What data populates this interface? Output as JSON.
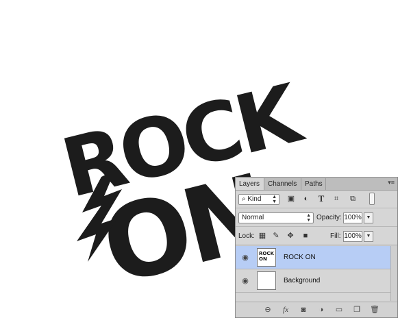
{
  "artwork": {
    "line1": "ROCK",
    "line2": "ON"
  },
  "colors": {
    "artwork": "#1c1c1c",
    "selected_layer": "#b7cdf5",
    "panel": "#d6d6d6"
  },
  "panel": {
    "tabs": [
      {
        "label": "Layers",
        "active": true
      },
      {
        "label": "Channels",
        "active": false
      },
      {
        "label": "Paths",
        "active": false
      }
    ],
    "menu_icon": "panel-menu-icon",
    "filter": {
      "kind_label": "Kind",
      "icons": [
        "image-filter-icon",
        "adjustment-filter-icon",
        "type-filter-icon",
        "shape-filter-icon",
        "smart-object-filter-icon"
      ]
    },
    "blend": {
      "mode": "Normal",
      "opacity_label": "Opacity:",
      "opacity_value": "100%"
    },
    "lock": {
      "label": "Lock:",
      "icons": [
        "lock-transparent-icon",
        "lock-image-icon",
        "lock-position-icon",
        "lock-all-icon"
      ],
      "fill_label": "Fill:",
      "fill_value": "100%"
    },
    "layers": [
      {
        "name": "ROCK ON",
        "selected": true,
        "thumb_text": "ROCK ON"
      },
      {
        "name": "Background",
        "selected": false
      }
    ],
    "footer_icons": [
      "link-layers-icon",
      "fx-icon",
      "add-mask-icon",
      "adjustment-layer-icon",
      "new-group-icon",
      "new-layer-icon",
      "delete-layer-icon"
    ]
  }
}
